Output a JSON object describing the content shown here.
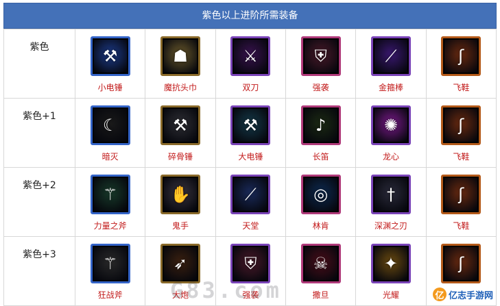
{
  "header": {
    "title": "紫色以上进阶所需装备"
  },
  "rows": [
    {
      "tier": "紫色",
      "items": [
        {
          "name": "小电锤",
          "icon": "hammer-icon",
          "color": "#1d3c8c",
          "glyph": "⚒"
        },
        {
          "name": "魔抗头巾",
          "icon": "helmet-icon",
          "color": "#6b5a2c",
          "glyph": "☗"
        },
        {
          "name": "双刀",
          "icon": "crossed-blades-icon",
          "color": "#3a1350",
          "glyph": "⚔"
        },
        {
          "name": "强袭",
          "icon": "armor-icon",
          "color": "#4a1a2a",
          "glyph": "⛨"
        },
        {
          "name": "金箍棒",
          "icon": "staff-icon",
          "color": "#3a1870",
          "glyph": "⟋"
        },
        {
          "name": "飞鞋",
          "icon": "boot-icon",
          "color": "#6a2a10",
          "glyph": "ʃ"
        }
      ]
    },
    {
      "tier": "紫色+1",
      "items": [
        {
          "name": "暗灭",
          "icon": "claw-blade-icon",
          "color": "#1a1a1a",
          "glyph": "☾"
        },
        {
          "name": "碎骨锤",
          "icon": "war-hammer-icon",
          "color": "#2f2f35",
          "glyph": "⚒"
        },
        {
          "name": "大电锤",
          "icon": "mace-icon",
          "color": "#153a4a",
          "glyph": "⚒"
        },
        {
          "name": "长笛",
          "icon": "flute-icon",
          "color": "#1c2a14",
          "glyph": "♪"
        },
        {
          "name": "龙心",
          "icon": "dragon-heart-icon",
          "color": "#7a1a8a",
          "glyph": "✺"
        },
        {
          "name": "飞鞋",
          "icon": "boot-icon",
          "color": "#6a2a10",
          "glyph": "ʃ"
        }
      ]
    },
    {
      "tier": "紫色+2",
      "items": [
        {
          "name": "力量之斧",
          "icon": "axe-icon",
          "color": "#183a2a",
          "glyph": "⚚"
        },
        {
          "name": "鬼手",
          "icon": "gauntlet-icon",
          "color": "#3a3540",
          "glyph": "✋"
        },
        {
          "name": "天堂",
          "icon": "halberd-icon",
          "color": "#1a2a5a",
          "glyph": "⟋"
        },
        {
          "name": "林肯",
          "icon": "orb-icon",
          "color": "#0e2a50",
          "glyph": "◎"
        },
        {
          "name": "深渊之刃",
          "icon": "abyssal-blade-icon",
          "color": "#2a2a3a",
          "glyph": "†"
        },
        {
          "name": "飞鞋",
          "icon": "boot-icon",
          "color": "#6a2a10",
          "glyph": "ʃ"
        }
      ]
    },
    {
      "tier": "紫色+3",
      "items": [
        {
          "name": "狂战斧",
          "icon": "battle-axe-icon",
          "color": "#2a2a2a",
          "glyph": "⚚"
        },
        {
          "name": "大炮",
          "icon": "crossbow-icon",
          "color": "#3a2010",
          "glyph": "➶"
        },
        {
          "name": "强袭",
          "icon": "armor-icon",
          "color": "#4a1a2a",
          "glyph": "⛨"
        },
        {
          "name": "撒旦",
          "icon": "skull-icon",
          "color": "#4a0e1a",
          "glyph": "☠"
        },
        {
          "name": "光耀",
          "icon": "radiance-sword-icon",
          "color": "#6a4a10",
          "glyph": "✦"
        },
        {
          "name": "飞鞋",
          "icon": "boot-icon",
          "color": "#6a2a10",
          "glyph": "ʃ"
        }
      ]
    }
  ],
  "watermark": {
    "text": "G83.com"
  },
  "brand": {
    "logo": "亿",
    "name": "亿志手游网"
  },
  "colors": {
    "header_bg": "#4471b8",
    "label": "#c21a1a",
    "border": "#d7d7d7"
  }
}
